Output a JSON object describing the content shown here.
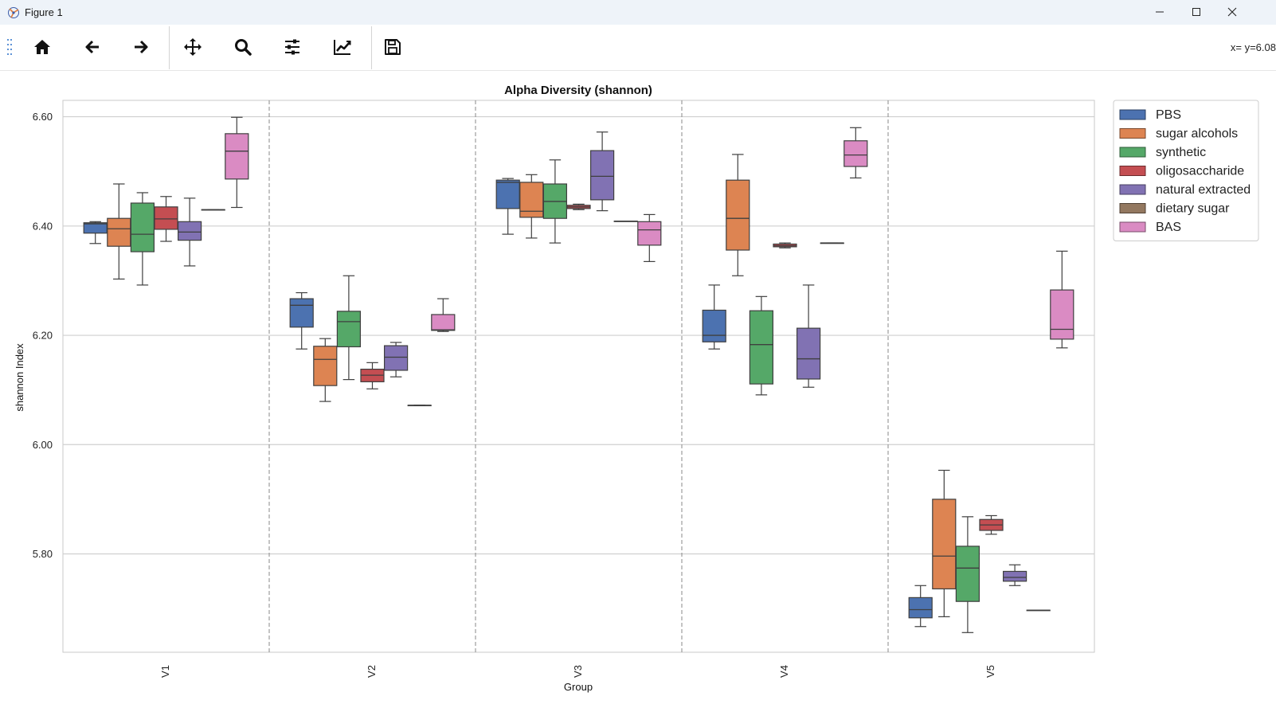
{
  "window": {
    "title": "Figure 1",
    "controls": [
      "minimize-icon",
      "maximize-icon",
      "close-icon"
    ]
  },
  "toolbar": {
    "buttons": [
      {
        "name": "home",
        "icon": "home-icon"
      },
      {
        "name": "back",
        "icon": "arrow-left-icon"
      },
      {
        "name": "forward",
        "icon": "arrow-right-icon"
      },
      {
        "name": "pan",
        "icon": "move-icon"
      },
      {
        "name": "zoom",
        "icon": "magnifier-icon"
      },
      {
        "name": "configure-subplots",
        "icon": "sliders-icon"
      },
      {
        "name": "edit-axis",
        "icon": "trend-line-icon"
      },
      {
        "name": "save",
        "icon": "floppy-disk-icon"
      }
    ],
    "coordinates": "x= y=6.08"
  },
  "chart_data": {
    "type": "box",
    "title": "Alpha Diversity (shannon)",
    "xlabel": "Group",
    "ylabel": "shannon Index",
    "categories": [
      "V1",
      "V2",
      "V3",
      "V4",
      "V5"
    ],
    "ylim": [
      5.62,
      6.63
    ],
    "yticks": [
      5.8,
      6.0,
      6.2,
      6.4,
      6.6
    ],
    "ytick_labels": [
      "5.80",
      "6.00",
      "6.20",
      "6.40",
      "6.60"
    ],
    "grid": "horizontal",
    "group_separators": "dashed",
    "legend_position": "upper right, outside plot",
    "series": [
      {
        "name": "PBS",
        "color": "#4c72b0",
        "boxes": [
          {
            "min": 6.368,
            "q1": 6.387,
            "median": 6.404,
            "q3": 6.406,
            "max": 6.408
          },
          {
            "min": 6.175,
            "q1": 6.215,
            "median": 6.255,
            "q3": 6.267,
            "max": 6.278
          },
          {
            "min": 6.385,
            "q1": 6.432,
            "median": 6.48,
            "q3": 6.484,
            "max": 6.487
          },
          {
            "min": 6.175,
            "q1": 6.188,
            "median": 6.2,
            "q3": 6.246,
            "max": 6.292
          },
          {
            "min": 5.667,
            "q1": 5.683,
            "median": 5.698,
            "q3": 5.72,
            "max": 5.742
          }
        ]
      },
      {
        "name": "sugar alcohols",
        "color": "#dd8452",
        "boxes": [
          {
            "min": 6.303,
            "q1": 6.363,
            "median": 6.395,
            "q3": 6.414,
            "max": 6.477
          },
          {
            "min": 6.079,
            "q1": 6.108,
            "median": 6.156,
            "q3": 6.18,
            "max": 6.194
          },
          {
            "min": 6.378,
            "q1": 6.416,
            "median": 6.427,
            "q3": 6.48,
            "max": 6.494
          },
          {
            "min": 6.309,
            "q1": 6.356,
            "median": 6.414,
            "q3": 6.484,
            "max": 6.531
          },
          {
            "min": 5.685,
            "q1": 5.736,
            "median": 5.796,
            "q3": 5.9,
            "max": 5.953
          }
        ]
      },
      {
        "name": "synthetic",
        "color": "#55a868",
        "boxes": [
          {
            "min": 6.292,
            "q1": 6.353,
            "median": 6.385,
            "q3": 6.442,
            "max": 6.461
          },
          {
            "min": 6.119,
            "q1": 6.179,
            "median": 6.225,
            "q3": 6.244,
            "max": 6.309
          },
          {
            "min": 6.369,
            "q1": 6.414,
            "median": 6.445,
            "q3": 6.477,
            "max": 6.521
          },
          {
            "min": 6.091,
            "q1": 6.111,
            "median": 6.183,
            "q3": 6.245,
            "max": 6.271
          },
          {
            "min": 5.656,
            "q1": 5.713,
            "median": 5.774,
            "q3": 5.814,
            "max": 5.868
          }
        ]
      },
      {
        "name": "oligosaccharide",
        "color": "#c44e52",
        "boxes": [
          {
            "min": 6.372,
            "q1": 6.394,
            "median": 6.413,
            "q3": 6.435,
            "max": 6.454
          },
          {
            "min": 6.102,
            "q1": 6.115,
            "median": 6.127,
            "q3": 6.138,
            "max": 6.15
          },
          {
            "min": 6.43,
            "q1": 6.432,
            "median": 6.435,
            "q3": 6.438,
            "max": 6.44
          },
          {
            "min": 6.36,
            "q1": 6.362,
            "median": 6.364,
            "q3": 6.367,
            "max": 6.369
          },
          {
            "min": 5.836,
            "q1": 5.843,
            "median": 5.853,
            "q3": 5.863,
            "max": 5.87
          }
        ]
      },
      {
        "name": "natural extracted",
        "color": "#8172b3",
        "boxes": [
          {
            "min": 6.327,
            "q1": 6.374,
            "median": 6.389,
            "q3": 6.408,
            "max": 6.451
          },
          {
            "min": 6.124,
            "q1": 6.136,
            "median": 6.16,
            "q3": 6.181,
            "max": 6.187
          },
          {
            "min": 6.428,
            "q1": 6.448,
            "median": 6.491,
            "q3": 6.538,
            "max": 6.572
          },
          {
            "min": 6.105,
            "q1": 6.12,
            "median": 6.157,
            "q3": 6.213,
            "max": 6.292
          },
          {
            "min": 5.742,
            "q1": 5.75,
            "median": 5.757,
            "q3": 5.768,
            "max": 5.78
          }
        ]
      },
      {
        "name": "dietary sugar",
        "color": "#937860",
        "boxes": [
          {
            "min": 6.43,
            "q1": 6.43,
            "median": 6.43,
            "q3": 6.43,
            "max": 6.43
          },
          {
            "min": 6.072,
            "q1": 6.072,
            "median": 6.072,
            "q3": 6.072,
            "max": 6.072
          },
          {
            "min": 6.409,
            "q1": 6.409,
            "median": 6.409,
            "q3": 6.409,
            "max": 6.409
          },
          {
            "min": 6.369,
            "q1": 6.369,
            "median": 6.369,
            "q3": 6.369,
            "max": 6.369
          },
          {
            "min": 5.697,
            "q1": 5.697,
            "median": 5.697,
            "q3": 5.697,
            "max": 5.697
          }
        ]
      },
      {
        "name": "BAS",
        "color": "#da8bc3",
        "boxes": [
          {
            "min": 6.434,
            "q1": 6.486,
            "median": 6.537,
            "q3": 6.569,
            "max": 6.599
          },
          {
            "min": 6.207,
            "q1": 6.209,
            "median": 6.21,
            "q3": 6.238,
            "max": 6.267
          },
          {
            "min": 6.335,
            "q1": 6.365,
            "median": 6.393,
            "q3": 6.408,
            "max": 6.421
          },
          {
            "min": 6.488,
            "q1": 6.509,
            "median": 6.53,
            "q3": 6.556,
            "max": 6.58
          },
          {
            "min": 6.177,
            "q1": 6.193,
            "median": 6.211,
            "q3": 6.283,
            "max": 6.354
          }
        ]
      }
    ]
  }
}
